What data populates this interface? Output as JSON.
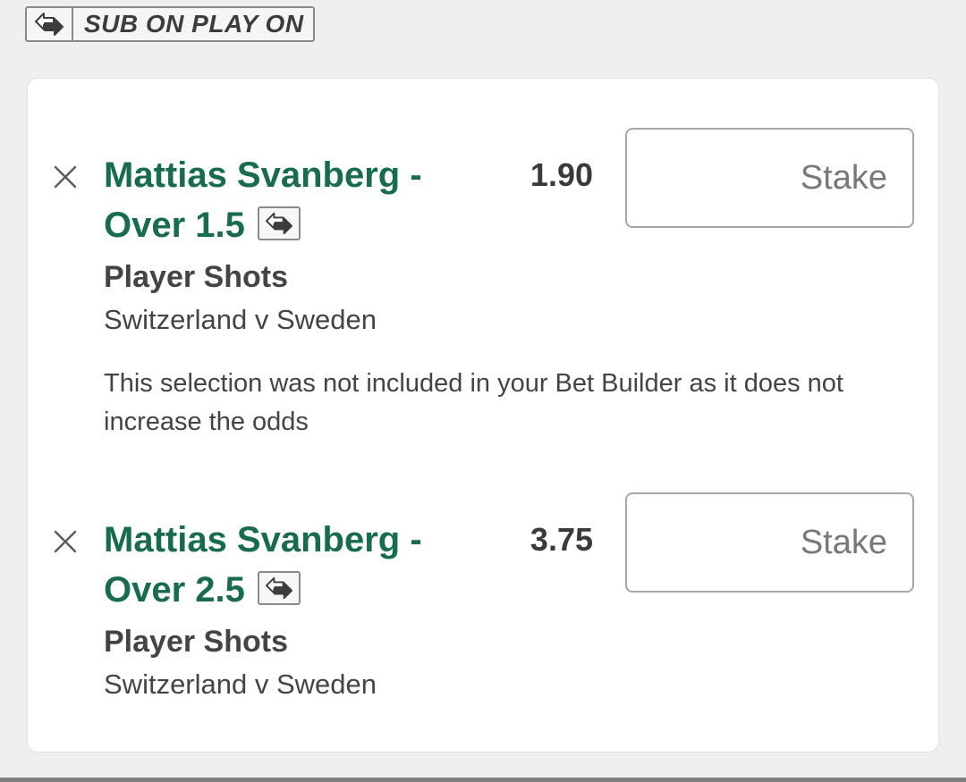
{
  "sub_badge": {
    "label": "SUB ON PLAY ON",
    "icon": "swap-arrows-icon"
  },
  "selections": [
    {
      "title": "Mattias Svanberg - Over 1.5",
      "title_line1": "Mattias Svanberg -",
      "title_line2": "Over 1.5",
      "odds": "1.90",
      "stake_placeholder": "Stake",
      "stake_value": "",
      "market": "Player Shots",
      "event": "Switzerland v Sweden",
      "notice": "This selection was not included in your Bet Builder as it does not increase the odds",
      "remove_icon": "close-icon",
      "sub_icon": "swap-arrows-icon"
    },
    {
      "title": "Mattias Svanberg - Over 2.5",
      "title_line1": "Mattias Svanberg -",
      "title_line2": "Over 2.5",
      "odds": "3.75",
      "stake_placeholder": "Stake",
      "stake_value": "",
      "market": "Player Shots",
      "event": "Switzerland v Sweden",
      "remove_icon": "close-icon",
      "sub_icon": "swap-arrows-icon"
    }
  ],
  "colors": {
    "selection_title": "#176b4f",
    "text": "#444444",
    "page_background": "#efefef",
    "card_background": "#ffffff"
  }
}
